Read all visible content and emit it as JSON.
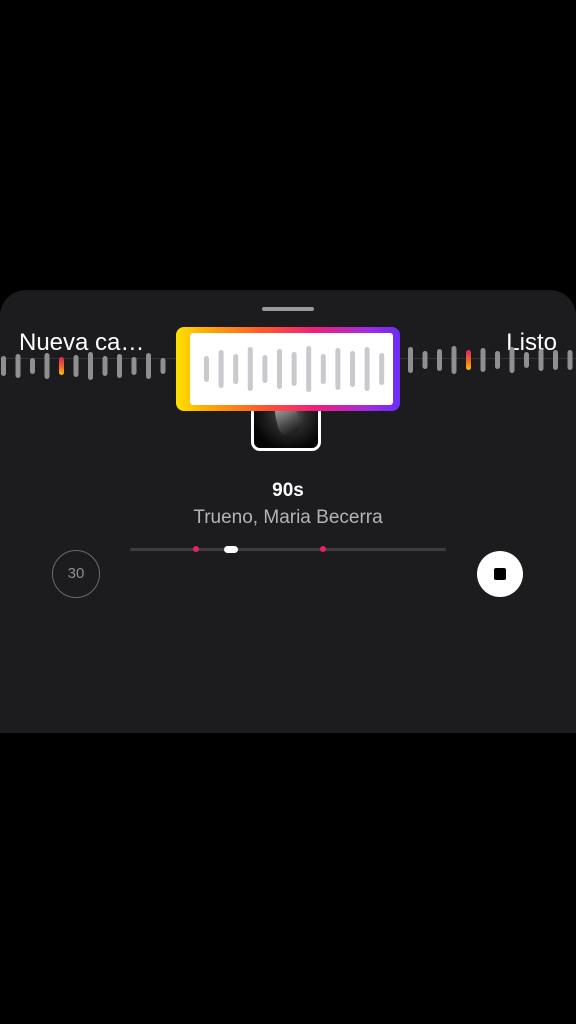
{
  "header": {
    "left_label": "Nueva ca…",
    "right_label": "Listo"
  },
  "track": {
    "title": "90s",
    "artist": "Trueno, Maria Becerra"
  },
  "duration": {
    "value": "30"
  },
  "playback": {
    "position_fraction": 0.32
  },
  "colors": {
    "sheet_bg": "#1c1c1e",
    "accent_pink": "#e0245e",
    "gradient": [
      "#ffe100",
      "#ff5a2a",
      "#f11f7a",
      "#6b2cf5"
    ]
  },
  "icons": {
    "stop": "stop-icon",
    "cover": "album-cover"
  }
}
